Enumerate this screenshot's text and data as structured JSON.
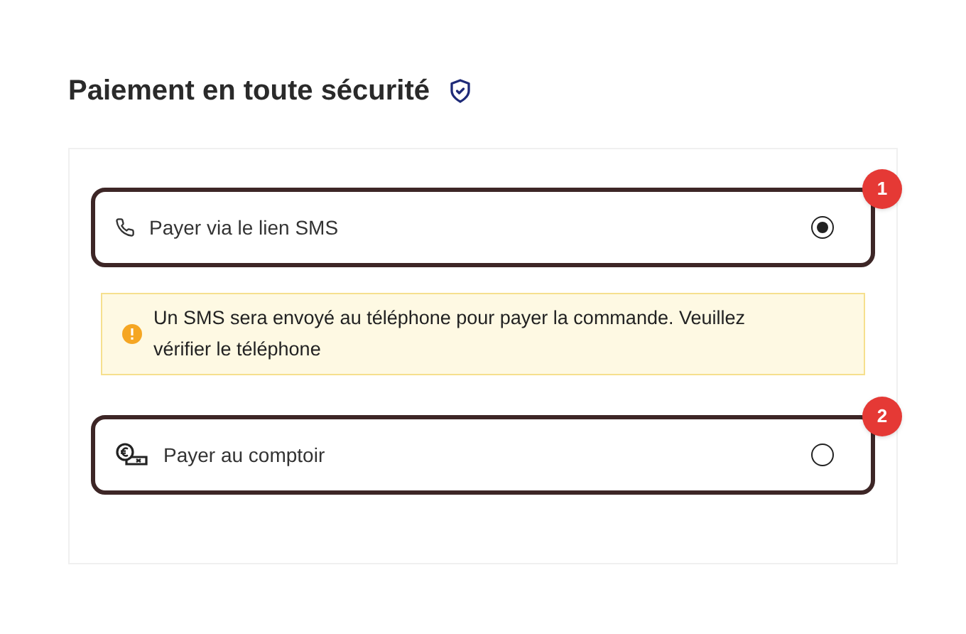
{
  "title": "Paiement en toute sécurité",
  "options": [
    {
      "kind": "phone",
      "label": "Payer via le lien SMS",
      "selected": true,
      "badge": "1",
      "notice": "Un SMS sera envoyé au téléphone pour payer la commande. Veuillez vérifier le téléphone"
    },
    {
      "kind": "cash",
      "label": "Payer au comptoir",
      "selected": false,
      "badge": "2"
    }
  ]
}
